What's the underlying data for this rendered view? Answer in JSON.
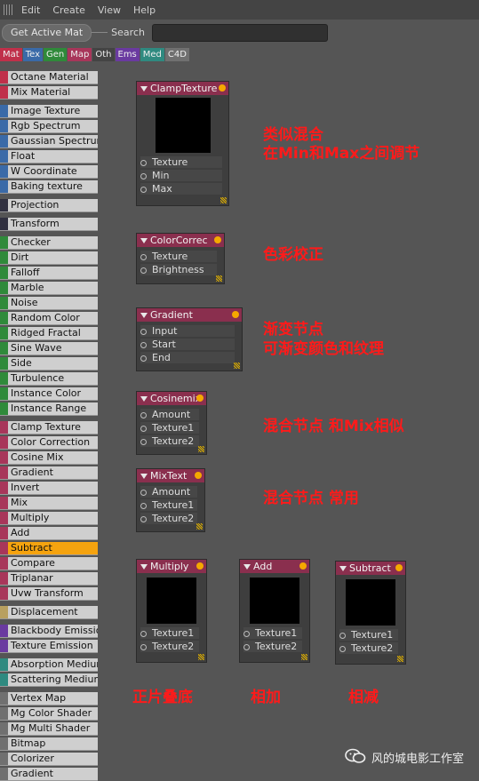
{
  "menu": [
    "Edit",
    "Create",
    "View",
    "Help"
  ],
  "toolbar": {
    "get_active_mat": "Get Active Mat",
    "search_label": "Search",
    "search_value": ""
  },
  "tabs": [
    {
      "label": "Mat",
      "color": "#c0304a"
    },
    {
      "label": "Tex",
      "color": "#3a6aa8"
    },
    {
      "label": "Gen",
      "color": "#2f8a3a"
    },
    {
      "label": "Map",
      "color": "#a8365a"
    },
    {
      "label": "Oth",
      "color": "#444444"
    },
    {
      "label": "Ems",
      "color": "#6a3aa0"
    },
    {
      "label": "Med",
      "color": "#2f8a80"
    },
    {
      "label": "C4D",
      "color": "#707070"
    }
  ],
  "list": [
    {
      "label": "Octane Material",
      "color": "#c0304a"
    },
    {
      "label": "Mix Material",
      "color": "#c0304a"
    },
    {
      "label": "Image Texture",
      "color": "#3a6aa8"
    },
    {
      "label": "Rgb Spectrum",
      "color": "#3a6aa8"
    },
    {
      "label": "Gaussian Spectrum",
      "color": "#3a6aa8"
    },
    {
      "label": "Float",
      "color": "#3a6aa8"
    },
    {
      "label": "W Coordinate",
      "color": "#3a6aa8"
    },
    {
      "label": "Baking texture",
      "color": "#3a6aa8"
    },
    {
      "label": "Projection",
      "color": "#303040"
    },
    {
      "label": "Transform",
      "color": "#303040"
    },
    {
      "label": "Checker",
      "color": "#2f8a3a"
    },
    {
      "label": "Dirt",
      "color": "#2f8a3a"
    },
    {
      "label": "Falloff",
      "color": "#2f8a3a"
    },
    {
      "label": "Marble",
      "color": "#2f8a3a"
    },
    {
      "label": "Noise",
      "color": "#2f8a3a"
    },
    {
      "label": "Random Color",
      "color": "#2f8a3a"
    },
    {
      "label": "Ridged Fractal",
      "color": "#2f8a3a"
    },
    {
      "label": "Sine Wave",
      "color": "#2f8a3a"
    },
    {
      "label": "Side",
      "color": "#2f8a3a"
    },
    {
      "label": "Turbulence",
      "color": "#2f8a3a"
    },
    {
      "label": "Instance Color",
      "color": "#2f8a3a"
    },
    {
      "label": "Instance Range",
      "color": "#2f8a3a"
    },
    {
      "label": "Clamp Texture",
      "color": "#a8365a"
    },
    {
      "label": "Color Correction",
      "color": "#a8365a"
    },
    {
      "label": "Cosine Mix",
      "color": "#a8365a"
    },
    {
      "label": "Gradient",
      "color": "#a8365a"
    },
    {
      "label": "Invert",
      "color": "#a8365a"
    },
    {
      "label": "Mix",
      "color": "#a8365a"
    },
    {
      "label": "Multiply",
      "color": "#a8365a"
    },
    {
      "label": "Add",
      "color": "#a8365a"
    },
    {
      "label": "Subtract",
      "color": "#a8365a",
      "selected": true
    },
    {
      "label": "Compare",
      "color": "#a8365a"
    },
    {
      "label": "Triplanar",
      "color": "#a8365a"
    },
    {
      "label": "Uvw Transform",
      "color": "#a8365a"
    },
    {
      "label": "Displacement",
      "color": "#b8a060"
    },
    {
      "label": "Blackbody Emission",
      "color": "#6a3aa0"
    },
    {
      "label": "Texture Emission",
      "color": "#6a3aa0"
    },
    {
      "label": "Absorption Medium",
      "color": "#2f8a80"
    },
    {
      "label": "Scattering Medium",
      "color": "#2f8a80"
    },
    {
      "label": "Vertex Map",
      "color": "#707070"
    },
    {
      "label": "Mg Color Shader",
      "color": "#707070"
    },
    {
      "label": "Mg Multi Shader",
      "color": "#707070"
    },
    {
      "label": "Bitmap",
      "color": "#707070"
    },
    {
      "label": "Colorizer",
      "color": "#707070"
    },
    {
      "label": "Gradient",
      "color": "#707070"
    }
  ],
  "nodes": [
    {
      "title": "ClampTexture",
      "ports": [
        "Texture",
        "Min",
        "Max"
      ],
      "preview": true
    },
    {
      "title": "ColorCorrec",
      "ports": [
        "Texture",
        "Brightness"
      ],
      "preview": false
    },
    {
      "title": "Gradient",
      "ports": [
        "Input",
        "Start",
        "End"
      ],
      "preview": false
    },
    {
      "title": "Cosinemix",
      "ports": [
        "Amount",
        "Texture1",
        "Texture2"
      ],
      "preview": false
    },
    {
      "title": "MixText",
      "ports": [
        "Amount",
        "Texture1",
        "Texture2"
      ],
      "preview": false
    },
    {
      "title": "Multiply",
      "ports": [
        "Texture1",
        "Texture2"
      ],
      "preview": true
    },
    {
      "title": "Add",
      "ports": [
        "Texture1",
        "Texture2"
      ],
      "preview": true
    },
    {
      "title": "Subtract",
      "ports": [
        "Texture1",
        "Texture2"
      ],
      "preview": true
    }
  ],
  "notes": [
    "类似混合",
    "在Min和Max之间调节",
    "色彩校正",
    "渐变节点",
    "可渐变颜色和纹理",
    "混合节点 和Mix相似",
    "混合节点 常用",
    "正片叠底",
    "相加",
    "相减"
  ],
  "watermark": "风的城电影工作室",
  "colors": {
    "node_header": "#8a2f4e",
    "node_body": "#3e3e3e",
    "note": "#ff1a1a",
    "selected": "#f5a30f"
  }
}
